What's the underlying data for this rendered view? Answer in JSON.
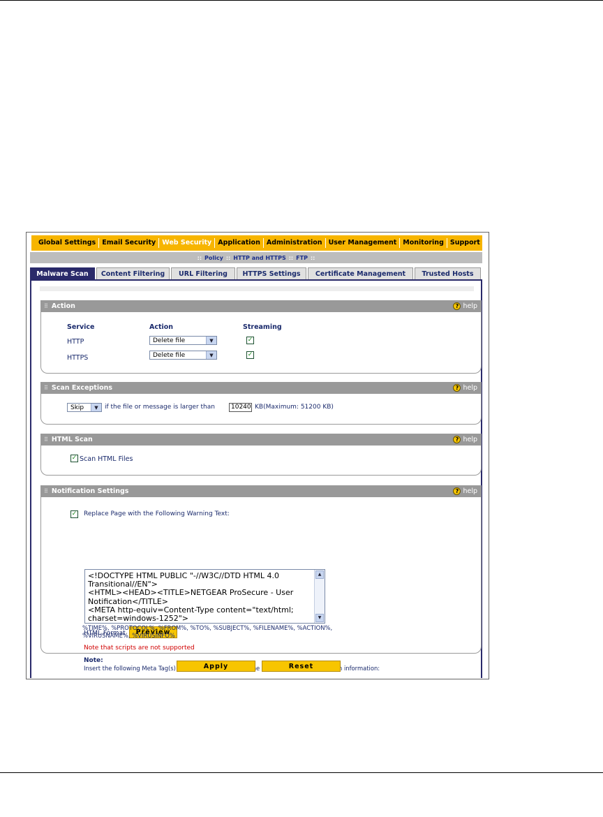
{
  "main_nav": [
    "Global Settings",
    "Email Security",
    "Web Security",
    "Application",
    "Administration",
    "User Management",
    "Monitoring",
    "Support"
  ],
  "sub_nav": {
    "sep": "::",
    "policy": "Policy",
    "http": "HTTP and HTTPS",
    "ftp": "FTP"
  },
  "tabs": [
    "Malware Scan",
    "Content Filtering",
    "URL Filtering",
    "HTTPS Settings",
    "Certificate Management",
    "Trusted Hosts"
  ],
  "help_label": "help",
  "action": {
    "title": "Action",
    "col_service": "Service",
    "col_action": "Action",
    "col_streaming": "Streaming",
    "rows": [
      {
        "service": "HTTP",
        "action": "Delete file",
        "streaming": true
      },
      {
        "service": "HTTPS",
        "action": "Delete file",
        "streaming": true
      }
    ]
  },
  "scan_exceptions": {
    "title": "Scan Exceptions",
    "select": "Skip",
    "text_before": "if the file or message is larger than",
    "size": "10240",
    "text_after": "KB(Maximum: 51200 KB)"
  },
  "html_scan": {
    "title": "HTML Scan",
    "label": "Scan HTML Files",
    "checked": true
  },
  "notification": {
    "title": "Notification Settings",
    "replace_label": "Replace Page with the Following Warning Text:",
    "replace_checked": true,
    "warning_text": "<!DOCTYPE HTML PUBLIC \"-//W3C//DTD HTML 4.0 Transitional//EN\">\n<HTML><HEAD><TITLE>NETGEAR ProSecure - User Notification</TITLE>\n<META http-equiv=Content-Type content=\"text/html; charset=windows-1252\">",
    "format_label": "HTML Format",
    "preview": "Preview",
    "scripts_note": "Note that scripts are not supported",
    "note_title": "Note:",
    "note_line1": "Insert the following Meta Tag(s) to automatically include the relevant malware detection information:",
    "note_line2": "%TIME%, %PROTOCOL%, %FROM%, %TO%, %SUBJECT%, %FILENAME%, %ACTION%,",
    "note_line3": "%VIRUSNAME%, %VIRUSINFO%"
  },
  "buttons": {
    "apply": "Apply",
    "reset": "Reset"
  }
}
